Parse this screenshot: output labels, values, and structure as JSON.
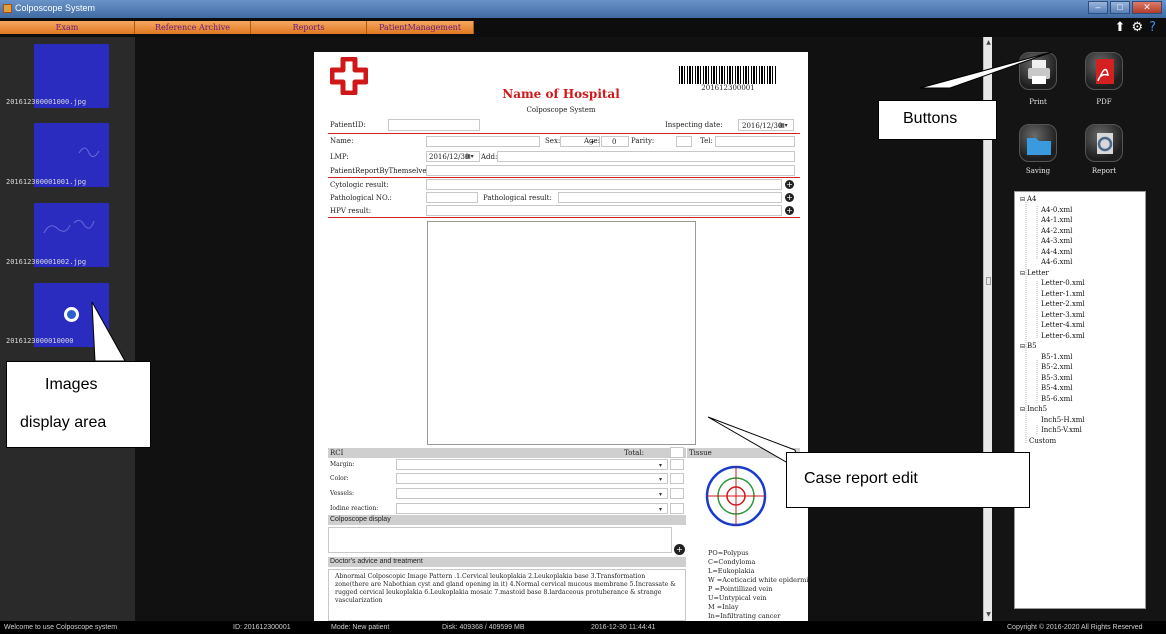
{
  "window": {
    "title": "Colposcope System"
  },
  "menu": {
    "tabs": [
      "Exam",
      "Reference Archive",
      "Reports",
      "PatientManagement"
    ]
  },
  "thumbnails": [
    {
      "name": "201612300001000.jpg",
      "type": "image"
    },
    {
      "name": "201612300001001.jpg",
      "type": "image"
    },
    {
      "name": "201612300001002.jpg",
      "type": "image"
    },
    {
      "name": "2016123000010000",
      "type": "video"
    }
  ],
  "report": {
    "barcode_number": "201612300001",
    "hospital_name": "Name of Hospital",
    "system_name": "Colposcope System",
    "patient_id_label": "PatientID:",
    "inspecting_date_label": "Inspecting date:",
    "inspecting_date": "2016/12/30",
    "name_label": "Name:",
    "sex_label": "Sex:",
    "age_label": "Age:",
    "age_value": "0",
    "parity_label": "Parity:",
    "tel_label": "Tel:",
    "lmp_label": "LMP:",
    "lmp_date": "2016/12/30",
    "add_label": "Add:",
    "self_report_label": "PatientReportByThemselves:",
    "cytologic_label": "Cytologic result:",
    "pathological_no_label": "Pathological NO.:",
    "pathological_result_label": "Pathological  result:",
    "hpv_label": "HPV result:",
    "rci_header": "RCI",
    "total_label": "Total:",
    "tissue_header": "Tissue",
    "rci_rows": [
      "Margin:",
      "Color:",
      "Vessels:",
      "Iodine reaction:"
    ],
    "colposcope_display_header": "Colposcope display",
    "advice_header": "Doctor's advice and treatment",
    "advice_text": "Abnormal Colposcopic Image Pattern .1.Cervical leukoplakia 2.Leukoplakia base 3.Transformation zone(there are  Nabothian cyst and gland opening in it) 4.Normal cervical mucous membrane  5.Incrassate & rugged cervical leukoplakia  6.Leukoplakia mosaic  7.mastoid base  8.lardaceous protuberance & strange vascularization",
    "legend": [
      "PO=Polypus",
      "C=Condyloma",
      "L=Eukoplakia",
      "W =Aceticacid white epidermis",
      "P =Pointillized vein",
      "U=Untypical vein",
      "M =Inlay",
      "In=Infiltrating cancer"
    ]
  },
  "right_buttons": [
    {
      "label": "Print",
      "icon": "printer-icon"
    },
    {
      "label": "PDF",
      "icon": "pdf-icon"
    },
    {
      "label": "Saving",
      "icon": "folder-icon"
    },
    {
      "label": "Report",
      "icon": "report-icon"
    }
  ],
  "template_tree": [
    {
      "label": "A4",
      "children": [
        "A4-0.xml",
        "A4-1.xml",
        "A4-2.xml",
        "A4-3.xml",
        "A4-4.xml",
        "A4-6.xml"
      ]
    },
    {
      "label": "Letter",
      "children": [
        "Letter-0.xml",
        "Letter-1.xml",
        "Letter-2.xml",
        "Letter-3.xml",
        "Letter-4.xml",
        "Letter-6.xml"
      ]
    },
    {
      "label": "B5",
      "children": [
        "B5-1.xml",
        "B5-2.xml",
        "B5-3.xml",
        "B5-4.xml",
        "B5-6.xml"
      ]
    },
    {
      "label": "Inch5",
      "children": [
        "Inch5-H.xml",
        "Inch5-V.xml"
      ]
    },
    {
      "label": "Custom",
      "children": []
    }
  ],
  "statusbar": {
    "welcome": "Welcome to use  Colposcope system",
    "id": "ID: 201612300001",
    "mode": "Mode:  New patient",
    "disk": "Disk:   409368 / 409599 MB",
    "datetime": "2016-12-30  11:44:41",
    "copyright": "Copyright © 2016-2020 All Rights Reserved"
  },
  "callouts": {
    "buttons": "Buttons",
    "images_line1": "Images",
    "images_line2": "display area",
    "case_report": "Case report edit"
  },
  "colors": {
    "accent_tab": "#e07820",
    "hospital_red": "#d01818",
    "thumb_blue": "#2a2cc0"
  }
}
